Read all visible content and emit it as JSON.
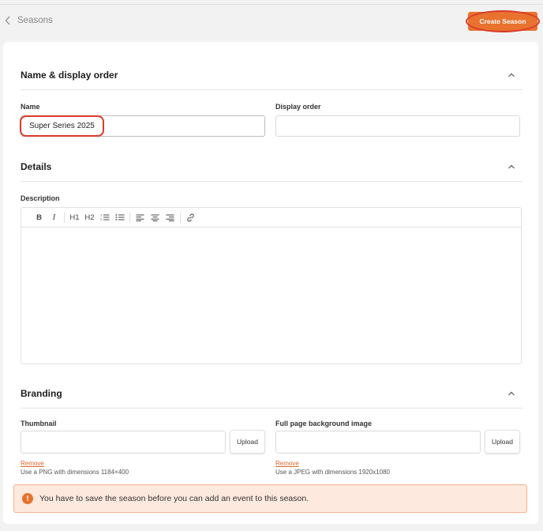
{
  "header": {
    "back_label": "Seasons",
    "create_button": "Create Season"
  },
  "sections": {
    "name_order": {
      "title": "Name & display order",
      "name_label": "Name",
      "name_value": "Super Series 2025",
      "display_order_label": "Display order",
      "display_order_value": ""
    },
    "details": {
      "title": "Details",
      "description_label": "Description",
      "toolbar": {
        "bold": "B",
        "italic": "I",
        "h1": "H1",
        "h2": "H2"
      }
    },
    "branding": {
      "title": "Branding",
      "thumbnail_label": "Thumbnail",
      "background_label": "Full page background image",
      "upload_label": "Upload",
      "remove_label": "Remove",
      "thumbnail_hint": "Use a PNG with dimensions 1184×400",
      "background_hint": "Use a JPEG with dimensions 1920x1080"
    }
  },
  "alert": {
    "icon": "!",
    "text": "You have to save the season before you can add an event to this season."
  },
  "colors": {
    "accent": "#e8722e",
    "highlight_ring": "#d93a2b",
    "alert_bg": "#fde9de"
  }
}
